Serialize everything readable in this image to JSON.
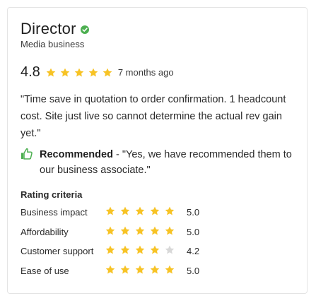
{
  "review": {
    "reviewer_title": "Director",
    "company": "Media business",
    "overall_rating": "4.8",
    "overall_rating_value": 4.8,
    "time_ago": "7 months ago",
    "quote": "\"Time save in quotation to order confirmation. 1 headcount cost. Site just live so cannot determine the actual rev gain yet.\"",
    "recommended_label": "Recommended",
    "recommended_text": " - \"Yes, we have recommended them to our business associate.\""
  },
  "criteria": {
    "heading": "Rating criteria",
    "items": [
      {
        "label": "Business impact",
        "score": "5.0",
        "value": 5.0
      },
      {
        "label": "Affordability",
        "score": "5.0",
        "value": 5.0
      },
      {
        "label": "Customer support",
        "score": "4.2",
        "value": 4.2
      },
      {
        "label": "Ease of use",
        "score": "5.0",
        "value": 5.0
      }
    ]
  },
  "colors": {
    "star_filled": "#f7c325",
    "star_empty": "#d8d8d8",
    "accent_green": "#4caf50"
  },
  "icons": {
    "verified": "verified-check-icon",
    "recommend": "thumbs-up-icon",
    "star": "star-icon"
  }
}
